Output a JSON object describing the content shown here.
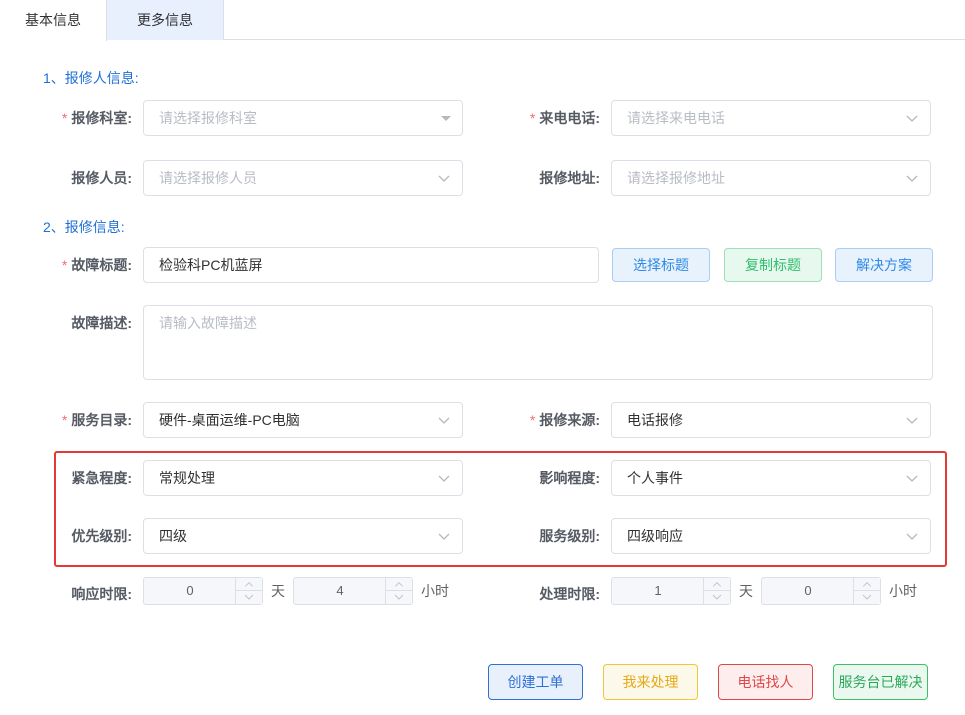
{
  "tabs": [
    {
      "label": "基本信息",
      "active": true
    },
    {
      "label": "更多信息",
      "active": false
    }
  ],
  "sections": {
    "reporter": "1、报修人信息:",
    "repair": "2、报修信息:"
  },
  "fields": {
    "dept": {
      "label": "报修科室:",
      "required": true,
      "placeholder": "请选择报修科室"
    },
    "phone": {
      "label": "来电电话:",
      "required": true,
      "placeholder": "请选择来电电话"
    },
    "person": {
      "label": "报修人员:",
      "required": false,
      "placeholder": "请选择报修人员"
    },
    "address": {
      "label": "报修地址:",
      "required": false,
      "placeholder": "请选择报修地址"
    },
    "title": {
      "label": "故障标题:",
      "required": true,
      "value": "检验科PC机蓝屏"
    },
    "desc": {
      "label": "故障描述:",
      "required": false,
      "placeholder": "请输入故障描述"
    },
    "catalog": {
      "label": "服务目录:",
      "required": true,
      "value": "硬件-桌面运维-PC电脑"
    },
    "source": {
      "label": "报修来源:",
      "required": true,
      "value": "电话报修"
    },
    "urgency": {
      "label": "紧急程度:",
      "value": "常规处理"
    },
    "impact": {
      "label": "影响程度:",
      "value": "个人事件"
    },
    "priority": {
      "label": "优先级别:",
      "value": "四级"
    },
    "service_level": {
      "label": "服务级别:",
      "value": "四级响应"
    },
    "response_limit": {
      "label": "响应时限:",
      "days": "0",
      "days_unit": "天",
      "hours": "4",
      "hours_unit": "小时"
    },
    "handle_limit": {
      "label": "处理时限:",
      "days": "1",
      "days_unit": "天",
      "hours": "0",
      "hours_unit": "小时"
    }
  },
  "title_buttons": {
    "select": "选择标题",
    "copy": "复制标题",
    "solution": "解决方案"
  },
  "footer_buttons": {
    "create": "创建工单",
    "self_handle": "我来处理",
    "phone_find": "电话找人",
    "resolved": "服务台已解决"
  },
  "required_mark": "*",
  "colors": {
    "accent": "#1f6fd6",
    "required": "#f56c6c",
    "highlight": "#e53935"
  },
  "icons": {
    "select_arrow": "chevron-down-icon",
    "dept_arrow": "caret-down-icon",
    "stepper_up": "chevron-up-icon",
    "stepper_down": "chevron-down-icon"
  }
}
